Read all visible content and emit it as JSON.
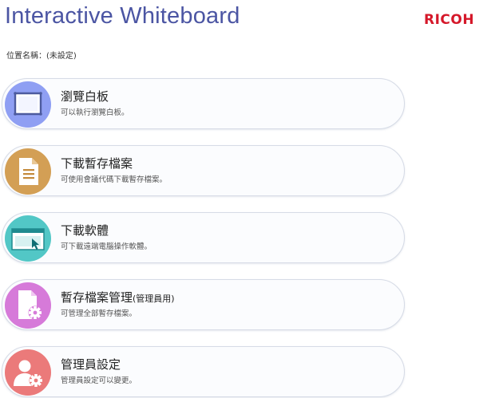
{
  "header": {
    "title": "Interactive Whiteboard",
    "logo_text": "RICOH",
    "location_label": "位置名稱：(未設定)"
  },
  "colors": {
    "title": "#4b55a3",
    "logo": "#d5182a",
    "icon_whiteboard": "#8f9ff3",
    "icon_document": "#d39f55",
    "icon_software": "#52c7c6",
    "icon_file_management": "#d67ad9",
    "icon_admin_settings": "#eb7a7a"
  },
  "menu": [
    {
      "title": "瀏覽白板",
      "title_suffix": "",
      "description": "可以執行瀏覽白板。",
      "icon": "whiteboard-icon"
    },
    {
      "title": "下載暫存檔案",
      "title_suffix": "",
      "description": "可使用會議代碼下載暫存檔案。",
      "icon": "document-icon"
    },
    {
      "title": "下載軟體",
      "title_suffix": "",
      "description": "可下載遠端電腦操作軟體。",
      "icon": "software-window-icon"
    },
    {
      "title": "暫存檔案管理",
      "title_suffix": "(管理員用)",
      "description": "可管理全部暫存檔案。",
      "icon": "file-gear-icon"
    },
    {
      "title": "管理員設定",
      "title_suffix": "",
      "description": "管理員設定可以變更。",
      "icon": "admin-gear-icon"
    }
  ]
}
